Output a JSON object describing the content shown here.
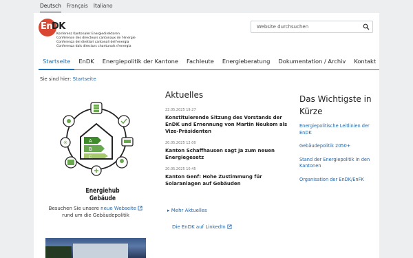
{
  "languages": [
    "Deutsch",
    "Français",
    "Italiano"
  ],
  "logo": {
    "en": "En",
    "dk": "DK",
    "lines": [
      "Konferenz Kantonaler Energiedirektoren",
      "Conférence des directeurs cantonaux de l'énergie",
      "Conferenza dei direttori cantonali dell'energia",
      "Conferenza dals directurs chantunals d'energia"
    ]
  },
  "search": {
    "placeholder": "Website durchsuchen"
  },
  "nav": [
    "Startseite",
    "EnDK",
    "Energiepolitik der Kantone",
    "Fachleute",
    "Energieberatung",
    "Dokumentation / Archiv",
    "Kontakt"
  ],
  "breadcrumb": {
    "prefix": "Sie sind hier:",
    "link": "Startseite"
  },
  "hub": {
    "title_line1": "Energiehub",
    "title_line2": "Gebäude",
    "labels": [
      "A",
      "B",
      "C"
    ],
    "visit_pre": "Besuchen Sie unsere",
    "visit_link": "neue Webseite",
    "visit_post": "rund um die Gebäudepolitik"
  },
  "news": {
    "title": "Aktuelles",
    "items": [
      {
        "date": "22.05.2025 19:27",
        "headline": "Konstituierende Sitzung des Vorstands der EnDK und Ernennung von Martin Neukom als Vize-Präsidenten"
      },
      {
        "date": "20.05.2025 12:00",
        "headline": "Kanton Schaffhausen sagt Ja zum neuen Energiegesetz"
      },
      {
        "date": "20.05.2025 10:45",
        "headline": "Kanton Genf: Hohe Zustimmung für Solaranlagen auf Gebäuden"
      }
    ],
    "more": "Mehr Aktuelles",
    "linkedin": "Die EnDK auf LinkedIn"
  },
  "important": {
    "title": "Das Wichtigste in Kürze",
    "links": [
      "Energiepolitische Leitlinien der EnDK",
      "Gebäudepolitik 2050+",
      "Stand der Energiepolitik in den Kantonen",
      "Organisation der EnDK/EnFK"
    ]
  },
  "colors": {
    "brand_red": "#d94733",
    "link_blue": "#2266a8",
    "nav_blue": "#1a6fb5",
    "green": "#6aa84f"
  }
}
